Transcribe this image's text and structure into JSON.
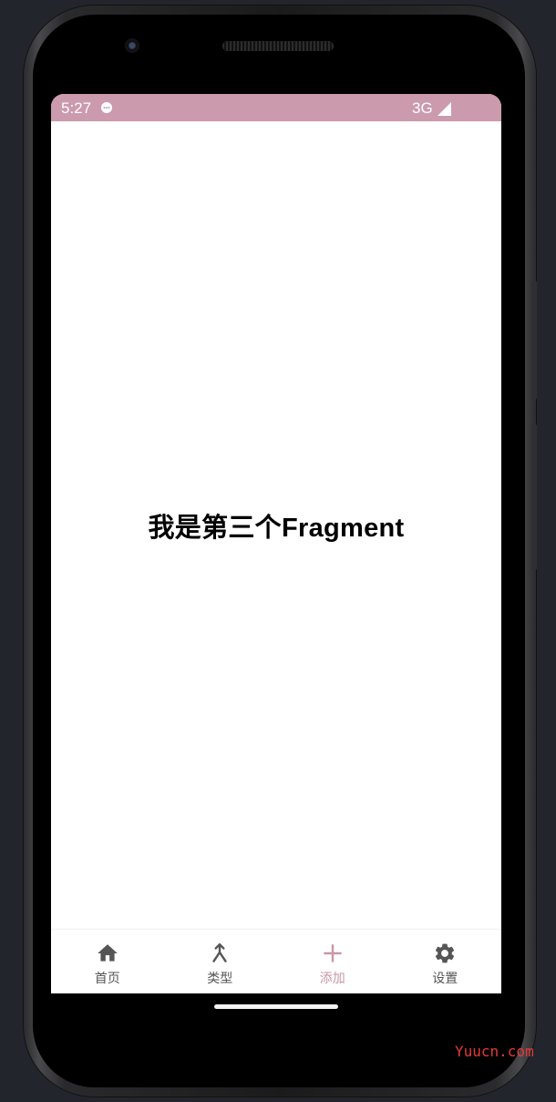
{
  "status_bar": {
    "time": "5:27",
    "network": "3G",
    "background_color": "#cb9aac",
    "icons": [
      "message-icon",
      "signal-icon"
    ]
  },
  "content": {
    "text": "我是第三个Fragment"
  },
  "bottom_nav": {
    "active_color": "#c996a8",
    "items": [
      {
        "label": "首页",
        "icon": "home-icon"
      },
      {
        "label": "类型",
        "icon": "merge-icon"
      },
      {
        "label": "添加",
        "icon": "plus-icon",
        "active": true
      },
      {
        "label": "设置",
        "icon": "settings-icon"
      }
    ]
  },
  "watermark": "Yuucn.com"
}
